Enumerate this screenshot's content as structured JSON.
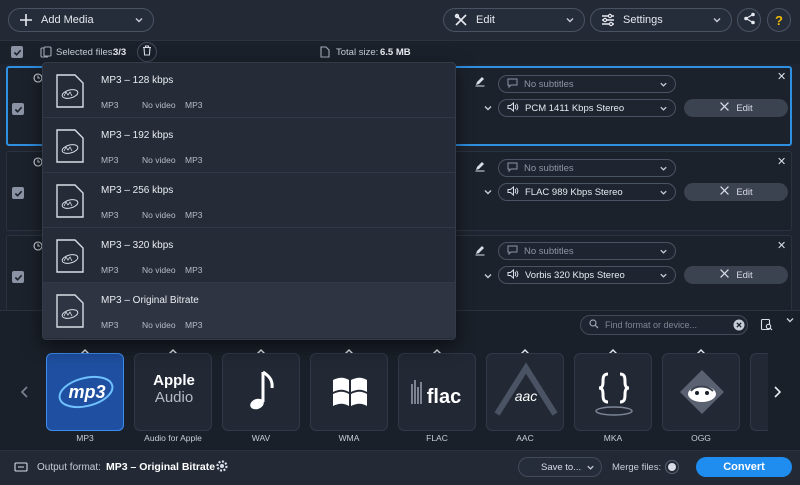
{
  "toolbar": {
    "add_media": "Add Media",
    "edit": "Edit",
    "settings": "Settings"
  },
  "selection": {
    "selected_label": "Selected files:",
    "selected_value": "3/3",
    "total_label": "Total size:",
    "total_value": "6.5 MB"
  },
  "rows": [
    {
      "subtitles": "No subtitles",
      "audio": "PCM 1411 Kbps Stereo",
      "edit": "Edit"
    },
    {
      "subtitles": "No subtitles",
      "audio": "FLAC 989 Kbps Stereo",
      "edit": "Edit"
    },
    {
      "subtitles": "No subtitles",
      "audio": "Vorbis 320 Kbps Stereo",
      "edit": "Edit"
    }
  ],
  "presets": [
    {
      "title": "MP3 – 128 kbps",
      "c1": "MP3",
      "c2": "No video",
      "c3": "MP3"
    },
    {
      "title": "MP3 – 192 kbps",
      "c1": "MP3",
      "c2": "No video",
      "c3": "MP3"
    },
    {
      "title": "MP3 – 256 kbps",
      "c1": "MP3",
      "c2": "No video",
      "c3": "MP3"
    },
    {
      "title": "MP3 – 320 kbps",
      "c1": "MP3",
      "c2": "No video",
      "c3": "MP3"
    },
    {
      "title": "MP3 – Original Bitrate",
      "c1": "MP3",
      "c2": "No video",
      "c3": "MP3"
    }
  ],
  "search": {
    "placeholder": "Find format or device..."
  },
  "formats": [
    {
      "label": "MP3",
      "icon": "mp3-icon"
    },
    {
      "label": "Audio for Apple",
      "icon": "apple-audio-icon",
      "line1": "Apple",
      "line2": "Audio"
    },
    {
      "label": "WAV",
      "icon": "music-note-icon"
    },
    {
      "label": "WMA",
      "icon": "windows-icon"
    },
    {
      "label": "FLAC",
      "icon": "flac-icon",
      "text": "flac"
    },
    {
      "label": "AAC",
      "icon": "aac-icon",
      "text": "aac"
    },
    {
      "label": "MKA",
      "icon": "mka-icon"
    },
    {
      "label": "OGG",
      "icon": "ogg-icon"
    }
  ],
  "tile_text": {
    "mp3": "mp3"
  },
  "bottom": {
    "output_label": "Output format:",
    "output_value": "MP3 – Original Bitrate",
    "save_to": "Save to...",
    "merge_files": "Merge files:",
    "convert": "Convert"
  },
  "colors": {
    "accent": "#1f8cf0",
    "selected_tile": "#1f4fa0",
    "background": "#1f2530"
  }
}
